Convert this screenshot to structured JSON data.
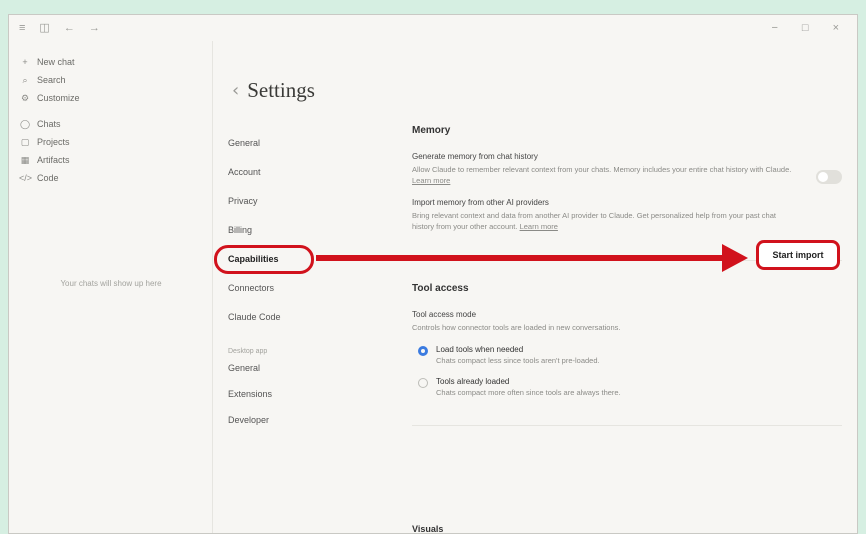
{
  "titlebar": {
    "menu_glyph": "≡",
    "sidebar_toggle_glyph": "◫",
    "back_glyph": "←",
    "forward_glyph": "→",
    "minimize_glyph": "−",
    "maximize_glyph": "□",
    "close_glyph": "×"
  },
  "sidebar": {
    "top": [
      {
        "icon": "plus-icon",
        "glyph": "+",
        "label": "New chat"
      },
      {
        "icon": "search-icon",
        "glyph": "⌕",
        "label": "Search"
      },
      {
        "icon": "customize-icon",
        "glyph": "⚙",
        "label": "Customize"
      }
    ],
    "sections": [
      {
        "icon": "chat-icon",
        "glyph": "◯",
        "label": "Chats"
      },
      {
        "icon": "folder-icon",
        "glyph": "▢",
        "label": "Projects"
      },
      {
        "icon": "artifacts-icon",
        "glyph": "▦",
        "label": "Artifacts"
      },
      {
        "icon": "code-icon",
        "glyph": "</>",
        "label": "Code"
      }
    ],
    "empty_hint": "Your chats will show up here"
  },
  "settings": {
    "back_glyph": "‹",
    "title": "Settings",
    "nav": [
      "General",
      "Account",
      "Privacy",
      "Billing",
      "Capabilities",
      "Connectors",
      "Claude Code"
    ],
    "active": "Capabilities",
    "desktop_heading": "Desktop app",
    "desktop_nav": [
      "General",
      "Extensions",
      "Developer"
    ]
  },
  "memory": {
    "title": "Memory",
    "generate_title": "Generate memory from chat history",
    "generate_desc": "Allow Claude to remember relevant context from your chats. Memory includes your entire chat history with Claude.",
    "generate_learn": "Learn more",
    "generate_toggle_on": false,
    "import_title": "Import memory from other AI providers",
    "import_desc": "Bring relevant context and data from another AI provider to Claude. Get personalized help from your past chat history from your other account.",
    "import_learn": "Learn more",
    "import_button": "Start import"
  },
  "tools": {
    "title": "Tool access",
    "mode_title": "Tool access mode",
    "mode_desc": "Controls how connector tools are loaded in new conversations.",
    "options": [
      {
        "label": "Load tools when needed",
        "desc": "Chats compact less since tools aren't pre-loaded.",
        "selected": true
      },
      {
        "label": "Tools already loaded",
        "desc": "Chats compact more often since tools are always there.",
        "selected": false
      }
    ]
  },
  "next_section_label": "Visuals",
  "colors": {
    "annotation": "#d1121c",
    "radio_selected": "#3b7be0",
    "background": "#d6efe2"
  }
}
